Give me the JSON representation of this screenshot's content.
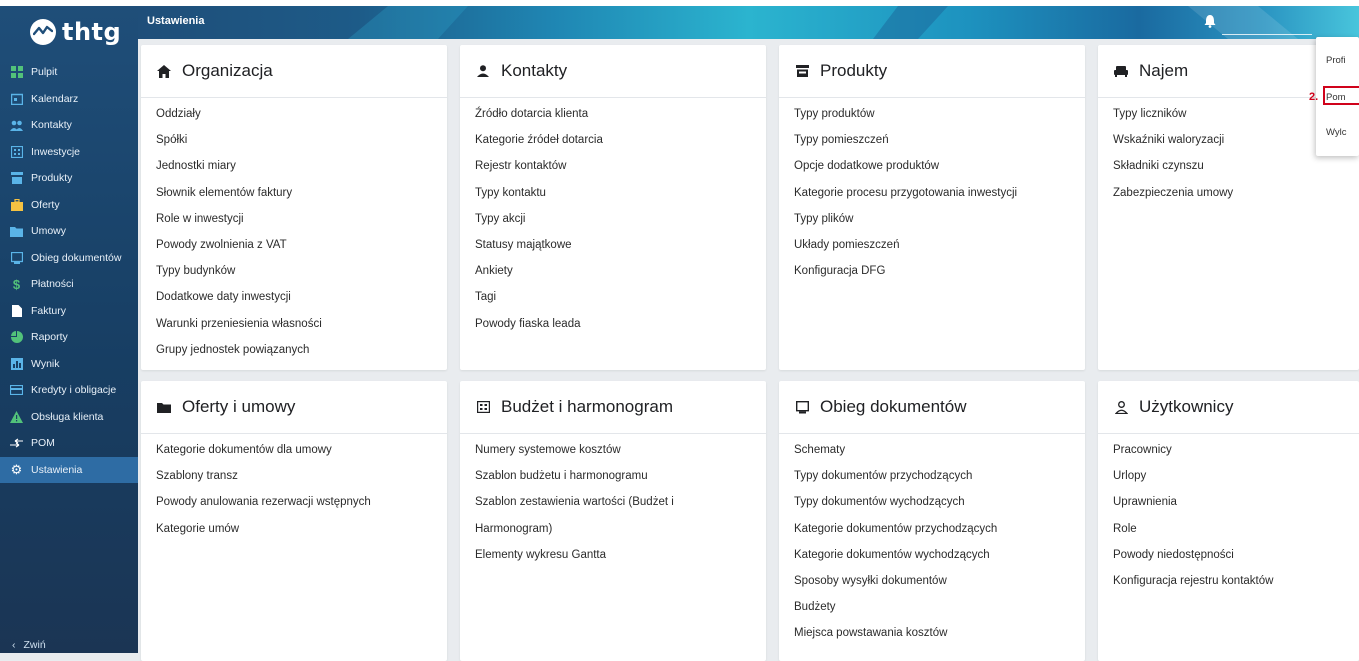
{
  "app": {
    "name": "thtg"
  },
  "header": {
    "title": "Ustawienia"
  },
  "sidebar": {
    "items": [
      {
        "label": "Pulpit",
        "icon": "dashboard-icon"
      },
      {
        "label": "Kalendarz",
        "icon": "calendar-icon"
      },
      {
        "label": "Kontakty",
        "icon": "people-icon"
      },
      {
        "label": "Inwestycje",
        "icon": "building-icon"
      },
      {
        "label": "Produkty",
        "icon": "storefront-icon"
      },
      {
        "label": "Oferty",
        "icon": "briefcase-icon"
      },
      {
        "label": "Umowy",
        "icon": "folder-icon"
      },
      {
        "label": "Obieg dokumentów",
        "icon": "inbox-icon"
      },
      {
        "label": "Płatności",
        "icon": "dollar-icon"
      },
      {
        "label": "Faktury",
        "icon": "file-icon"
      },
      {
        "label": "Raporty",
        "icon": "pie-chart-icon"
      },
      {
        "label": "Wynik",
        "icon": "bar-chart-icon"
      },
      {
        "label": "Kredyty i obligacje",
        "icon": "credit-card-icon"
      },
      {
        "label": "Obsługa klienta",
        "icon": "warning-icon"
      },
      {
        "label": "POM",
        "icon": "arrows-icon"
      },
      {
        "label": "Ustawienia",
        "icon": "gear-icon",
        "active": true
      }
    ],
    "collapse_label": "Zwiń"
  },
  "cards": {
    "organizacja": {
      "title": "Organizacja",
      "items": [
        "Oddziały",
        "Spółki",
        "Jednostki miary",
        "Słownik elementów faktury",
        "Role w inwestycji",
        "Powody zwolnienia z VAT",
        "Typy budynków",
        "Dodatkowe daty inwestycji",
        "Warunki przeniesienia własności",
        "Grupy jednostek powiązanych"
      ]
    },
    "kontakty": {
      "title": "Kontakty",
      "items": [
        "Źródło dotarcia klienta",
        "Kategorie źródeł dotarcia",
        "Rejestr kontaktów",
        "Typy kontaktu",
        "Typy akcji",
        "Statusy majątkowe",
        "Ankiety",
        "Tagi",
        "Powody fiaska leada"
      ]
    },
    "produkty": {
      "title": "Produkty",
      "items": [
        "Typy produktów",
        "Typy pomieszczeń",
        "Opcje dodatkowe produktów",
        "Kategorie procesu przygotowania inwestycji",
        "Typy plików",
        "Układy pomieszczeń",
        "Konfiguracja DFG"
      ]
    },
    "najem": {
      "title": "Najem",
      "items": [
        "Typy liczników",
        "Wskaźniki waloryzacji",
        "Składniki czynszu",
        "Zabezpieczenia umowy"
      ]
    },
    "oferty": {
      "title": "Oferty i umowy",
      "items": [
        "Kategorie dokumentów dla umowy",
        "Szablony transz",
        "Powody anulowania rezerwacji wstępnych",
        "Kategorie umów"
      ]
    },
    "budzet": {
      "title": "Budżet i harmonogram",
      "items": [
        "Numery systemowe kosztów",
        "Szablon budżetu i harmonogramu",
        "Szablon zestawienia wartości (Budżet i",
        "Harmonogram)",
        "Elementy wykresu Gantta"
      ]
    },
    "obieg": {
      "title": "Obieg dokumentów",
      "items": [
        "Schematy",
        "Typy dokumentów przychodzących",
        "Typy dokumentów wychodzących",
        "Kategorie dokumentów przychodzących",
        "Kategorie dokumentów wychodzących",
        "Sposoby wysyłki dokumentów",
        "Budżety",
        "Miejsca powstawania kosztów"
      ]
    },
    "uzytkownicy": {
      "title": "Użytkownicy",
      "items": [
        "Pracownicy",
        "Urlopy",
        "Uprawnienia",
        "Role",
        "Powody niedostępności",
        "Konfiguracja rejestru kontaktów"
      ]
    }
  },
  "user_menu": {
    "items": [
      "Profi",
      "Pom",
      "Wylc"
    ],
    "step_marker": "2."
  },
  "colors": {
    "sidebar": "#1f4e79",
    "active": "#2e6ca4",
    "highlight": "#d0021b"
  }
}
